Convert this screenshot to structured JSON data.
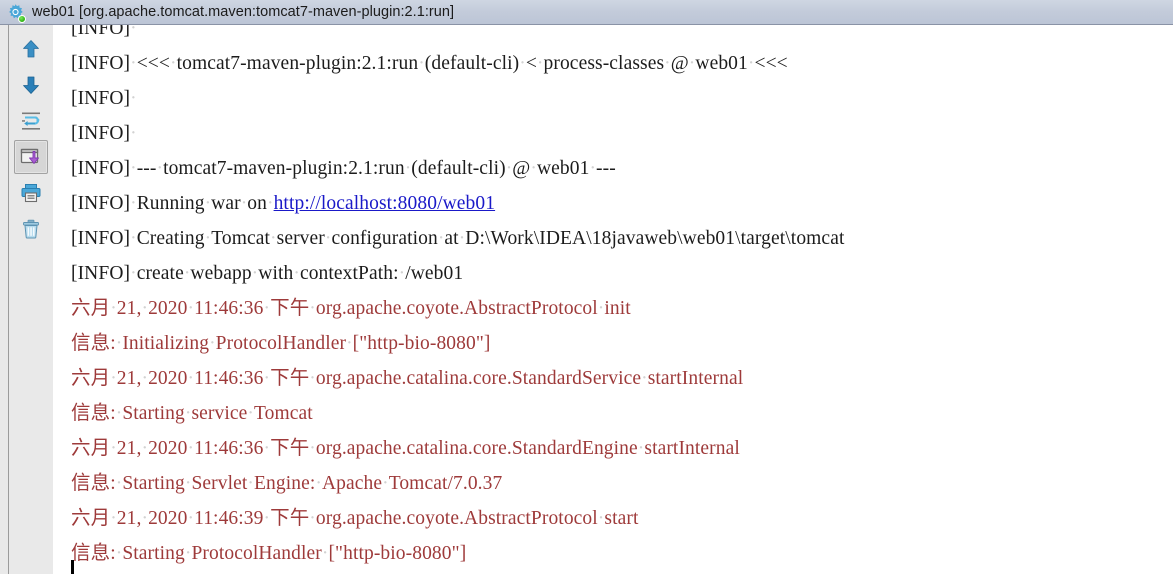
{
  "window": {
    "title": "web01 [org.apache.tomcat.maven:tomcat7-maven-plugin:2.1:run]",
    "icon": "gear-icon",
    "status_indicator": "running-green-dot",
    "titlebar_color": "#c3cbda"
  },
  "toolbar": {
    "buttons": [
      {
        "name": "up-arrow-icon",
        "label": "Up the Stack Trace",
        "selected": false,
        "color": "#3a8fc4"
      },
      {
        "name": "down-arrow-icon",
        "label": "Down the Stack Trace",
        "selected": false,
        "color": "#3a8fc4"
      },
      {
        "name": "soft-wrap-icon",
        "label": "Use Soft Wraps",
        "selected": false,
        "color": "#3a8fc4"
      },
      {
        "name": "scroll-to-end-icon",
        "label": "Scroll to the End",
        "selected": true,
        "color": "#9b59c8"
      },
      {
        "name": "print-icon",
        "label": "Print",
        "selected": false,
        "color": "#3a8fc4"
      },
      {
        "name": "trash-icon",
        "label": "Clear All",
        "selected": false,
        "color": "#5fa8d8"
      }
    ]
  },
  "console": {
    "colors": {
      "stdout": "#1c1c1c",
      "stderr": "#9e3a3a",
      "link": "#1a19c8",
      "whitespace_dot": "#d2d2d2",
      "background": "#ffffff"
    },
    "link_text": "http://localhost:8080/web01",
    "lines": [
      {
        "type": "stdout",
        "text": "[INFO]·"
      },
      {
        "type": "stdout",
        "text": "[INFO]·<<<·tomcat7-maven-plugin:2.1:run·(default-cli)·<·process-classes·@·web01·<<<"
      },
      {
        "type": "stdout",
        "text": "[INFO]·"
      },
      {
        "type": "stdout",
        "text": "[INFO]·"
      },
      {
        "type": "stdout",
        "text": "[INFO]·---·tomcat7-maven-plugin:2.1:run·(default-cli)·@·web01·---"
      },
      {
        "type": "stdout",
        "text": "[INFO]·Running·war·on·http://localhost:8080/web01",
        "link": "http://localhost:8080/web01"
      },
      {
        "type": "stdout",
        "text": "[INFO]·Creating·Tomcat·server·configuration·at·D:\\Work\\IDEA\\18javaweb\\web01\\target\\tomcat"
      },
      {
        "type": "stdout",
        "text": "[INFO]·create·webapp·with·contextPath:·/web01"
      },
      {
        "type": "stderr",
        "text": "六月·21,·2020·11:46:36·下午·org.apache.coyote.AbstractProtocol·init"
      },
      {
        "type": "stderr",
        "text": "信息:·Initializing·ProtocolHandler·[\"http-bio-8080\"]"
      },
      {
        "type": "stderr",
        "text": "六月·21,·2020·11:46:36·下午·org.apache.catalina.core.StandardService·startInternal"
      },
      {
        "type": "stderr",
        "text": "信息:·Starting·service·Tomcat"
      },
      {
        "type": "stderr",
        "text": "六月·21,·2020·11:46:36·下午·org.apache.catalina.core.StandardEngine·startInternal"
      },
      {
        "type": "stderr",
        "text": "信息:·Starting·Servlet·Engine:·Apache·Tomcat/7.0.37"
      },
      {
        "type": "stderr",
        "text": "六月·21,·2020·11:46:39·下午·org.apache.coyote.AbstractProtocol·start"
      },
      {
        "type": "stderr",
        "text": "信息:·Starting·ProtocolHandler·[\"http-bio-8080\"]"
      }
    ]
  }
}
